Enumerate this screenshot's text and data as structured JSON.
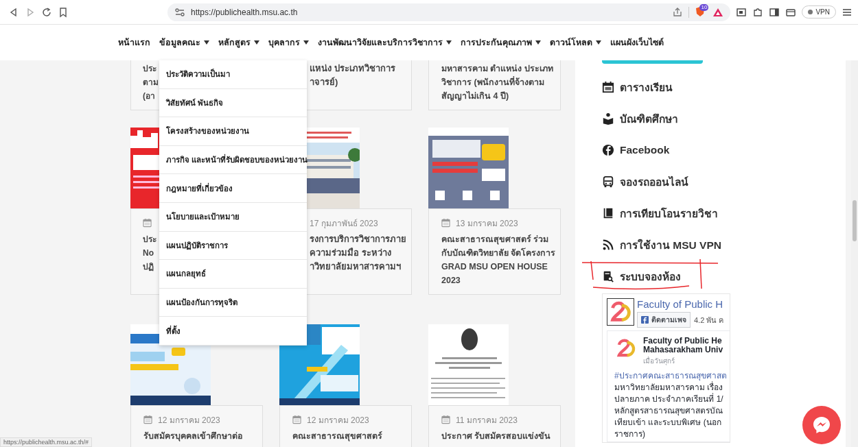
{
  "browser": {
    "url": "https://publichealth.msu.ac.th",
    "shield_count": "10",
    "vpn_label": "VPN"
  },
  "nav": [
    {
      "label": "หน้าแรก",
      "kind": "link"
    },
    {
      "label": "ข้อมูลคณะ",
      "kind": "dropdown",
      "expanded": true,
      "menu": [
        "ประวัติความเป็นมา",
        "วิสัยทัศน์ พันธกิจ",
        "โครงสร้างของหน่วยงาน",
        "ภารกิจ และหน้าที่รับผิดชอบของหน่วยงาน",
        "กฎหมายที่เกี่ยวข้อง",
        "นโยบายและเป้าหมาย",
        "แผนปฏิบัติราชการ",
        "แผนกลยุทธ์",
        "แผนป้องกันการทุจริต",
        "ที่ตั้ง"
      ]
    },
    {
      "label": "หลักสูตร",
      "kind": "dropdown"
    },
    {
      "label": "บุคลากร",
      "kind": "dropdown"
    },
    {
      "label": "งานพัฒนาวิจัยและบริการวิชาการ",
      "kind": "dropdown"
    },
    {
      "label": "การประกันคุณภาพ",
      "kind": "dropdown"
    },
    {
      "label": "ดาวน์โหลด",
      "kind": "dropdown"
    },
    {
      "label": "แผนผังเว็บไซต์",
      "kind": "link"
    }
  ],
  "cards": [
    {
      "kind": "partial",
      "title_lines": [
        "ประ",
        "ตาม",
        "(อา"
      ]
    },
    {
      "kind": "partial",
      "title_lines": [
        "แหน่ง ประเภทวิชาการ",
        "าจารย์)"
      ]
    },
    {
      "kind": "full",
      "title": "มหาสารคาม ตำแหน่ง ประเภทวิชาการ (พนักงานที่จ้างตามสัญญาไม่เกิน 4 ปี)"
    },
    {
      "kind": "partial",
      "calendar_icon": true,
      "title_lines": [
        "ประ",
        "No",
        "ปฏิ"
      ]
    },
    {
      "kind": "partial",
      "calendar_icon": false,
      "date": "17 กุมภาพันธ์ 2023",
      "title_lines": [
        "รงการบริการวิชาการภาย",
        "ความร่วมมือ ระหว่าง",
        "าวิทยาลัยมหาสารคามฯ"
      ]
    },
    {
      "kind": "full",
      "calendar_icon": true,
      "date": "13 มกราคม 2023",
      "title": "คณะสาธารณสุขศาสตร์ ร่วมกับบัณฑิตวิทยาลัย จัดโครงการ GRAD MSU OPEN HOUSE 2023"
    },
    {
      "kind": "full",
      "calendar_icon": true,
      "date": "12 มกราคม 2023",
      "title": "รับสมัครบุคคลเข้าศึกษาต่อ"
    },
    {
      "kind": "full",
      "calendar_icon": true,
      "date": "12 มกราคม 2023",
      "title": "คณะสาธารณสุขศาสตร์"
    },
    {
      "kind": "full",
      "calendar_icon": true,
      "date": "11 มกราคม 2023",
      "title": "ประกาศ รับสมัครสอบแข่งขัน"
    }
  ],
  "sidebar": {
    "links": [
      "ตารางเรียน",
      "บัณฑิตศึกษา",
      "Facebook",
      "จองรถออนไลน์",
      "การเทียบโอนรายวิชา",
      "การใช้งาน MSU VPN",
      "ระบบจองห้อง"
    ]
  },
  "facebook_widget": {
    "page_name": "Faculty of Public H",
    "follow_label": "ติดตามเพจ",
    "followers": "4.2 พัน ค",
    "post": {
      "author_lines": [
        "Faculty of Public He",
        "Mahasarakham Univ"
      ],
      "time": "เมื่อวันศุกร์",
      "hashtag": "#ประกาศคณะสาธารณสุขศาสต",
      "lines": [
        "มหาวิทยาลัยมหาสารคาม เรื่อง",
        "ปลายภาค ประจำภาคเรียนที่ 1/",
        "หลักสูตรสาธารณสุขศาสตรบัณ",
        "เทียบเข้า และระบบพิเศษ (นอก",
        "ราชการ)"
      ]
    }
  },
  "status_url": "https://publichealth.msu.ac.th/#"
}
